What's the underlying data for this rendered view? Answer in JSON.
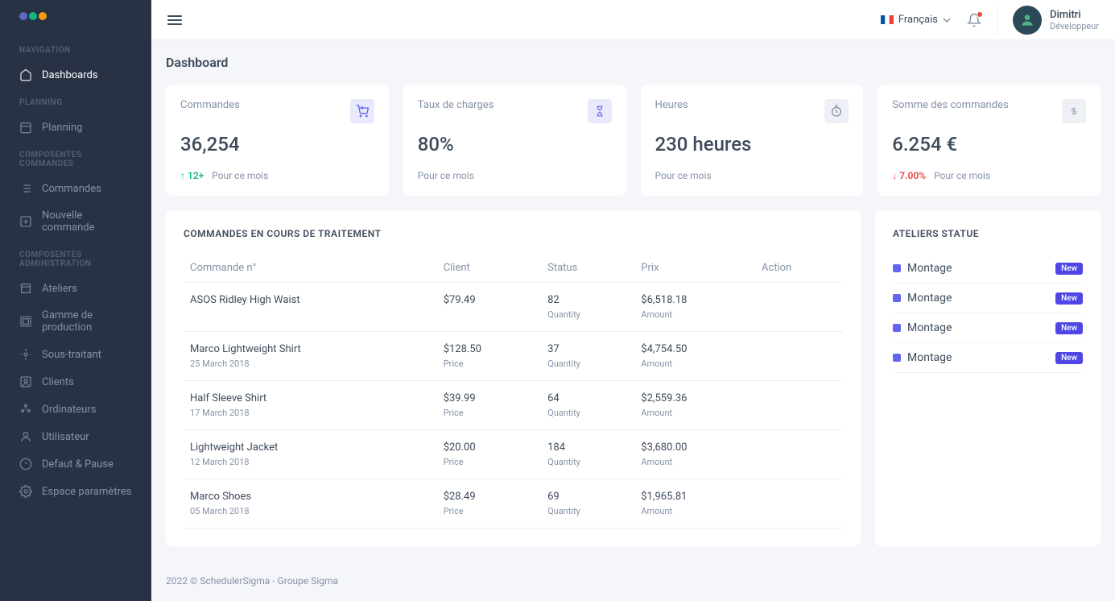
{
  "sidebar": {
    "sections": [
      {
        "title": "NAVIGATION",
        "items": [
          {
            "label": "Dashboards",
            "active": true
          }
        ]
      },
      {
        "title": "PLANNING",
        "items": [
          {
            "label": "Planning"
          }
        ]
      },
      {
        "title": "COMPOSENTES COMMANDES",
        "items": [
          {
            "label": "Commandes"
          },
          {
            "label": "Nouvelle commande"
          }
        ]
      },
      {
        "title": "COMPOSENTES ADMINISTRATION",
        "items": [
          {
            "label": "Ateliers"
          },
          {
            "label": "Gamme de production"
          },
          {
            "label": "Sous-traitant"
          },
          {
            "label": "Clients"
          },
          {
            "label": "Ordinateurs"
          },
          {
            "label": "Utilisateur"
          },
          {
            "label": "Defaut & Pause"
          },
          {
            "label": "Espace paramètres"
          }
        ]
      }
    ]
  },
  "topbar": {
    "language": "Français",
    "user": {
      "name": "Dimitri",
      "role": "Développeur"
    }
  },
  "page": {
    "title": "Dashboard"
  },
  "stats": [
    {
      "label": "Commandes",
      "value": "36,254",
      "trend": "12+",
      "trendDir": "up",
      "sub": "Pour ce mois",
      "iconBg": "#e8e9fb",
      "icon": "cart"
    },
    {
      "label": "Taux de charges",
      "value": "80%",
      "trend": "",
      "trendDir": "",
      "sub": "Pour ce mois",
      "iconBg": "#e8e9fb",
      "icon": "hourglass"
    },
    {
      "label": "Heures",
      "value": "230 heures",
      "trend": "",
      "trendDir": "",
      "sub": "Pour ce mois",
      "iconBg": "#eef0f5",
      "icon": "timer"
    },
    {
      "label": "Somme des commandes",
      "value": "6.254 €",
      "trend": "7.00%",
      "trendDir": "down",
      "sub": "Pour ce mois",
      "iconBg": "#eef0f5",
      "icon": "dollar"
    }
  ],
  "ordersPanel": {
    "title": "COMMANDES EN COURS DE TRAITEMENT",
    "columns": {
      "c1": "Commande n°",
      "c2": "Client",
      "c3": "Status",
      "c4": "Prix",
      "c5": "Action"
    },
    "rows": [
      {
        "name": "ASOS Ridley High Waist",
        "date": "",
        "price": "$79.49",
        "priceLabel": "",
        "qty": "82",
        "qtyLabel": "Quantity",
        "amount": "$6,518.18",
        "amountLabel": "Amount"
      },
      {
        "name": "Marco Lightweight Shirt",
        "date": "25 March 2018",
        "price": "$128.50",
        "priceLabel": "Price",
        "qty": "37",
        "qtyLabel": "Quantity",
        "amount": "$4,754.50",
        "amountLabel": "Amount"
      },
      {
        "name": "Half Sleeve Shirt",
        "date": "17 March 2018",
        "price": "$39.99",
        "priceLabel": "Price",
        "qty": "64",
        "qtyLabel": "Quantity",
        "amount": "$2,559.36",
        "amountLabel": "Amount"
      },
      {
        "name": "Lightweight Jacket",
        "date": "12 March 2018",
        "price": "$20.00",
        "priceLabel": "Price",
        "qty": "184",
        "qtyLabel": "Quantity",
        "amount": "$3,680.00",
        "amountLabel": "Amount"
      },
      {
        "name": "Marco Shoes",
        "date": "05 March 2018",
        "price": "$28.49",
        "priceLabel": "Price",
        "qty": "69",
        "qtyLabel": "Quantity",
        "amount": "$1,965.81",
        "amountLabel": "Amount"
      }
    ]
  },
  "ateliersPanel": {
    "title": "ATELIERS STATUE",
    "items": [
      {
        "label": "Montage",
        "badge": "New"
      },
      {
        "label": "Montage",
        "badge": "New"
      },
      {
        "label": "Montage",
        "badge": "New"
      },
      {
        "label": "Montage",
        "badge": "New"
      }
    ]
  },
  "footer": "2022 © SchedulerSigma - Groupe Sigma"
}
